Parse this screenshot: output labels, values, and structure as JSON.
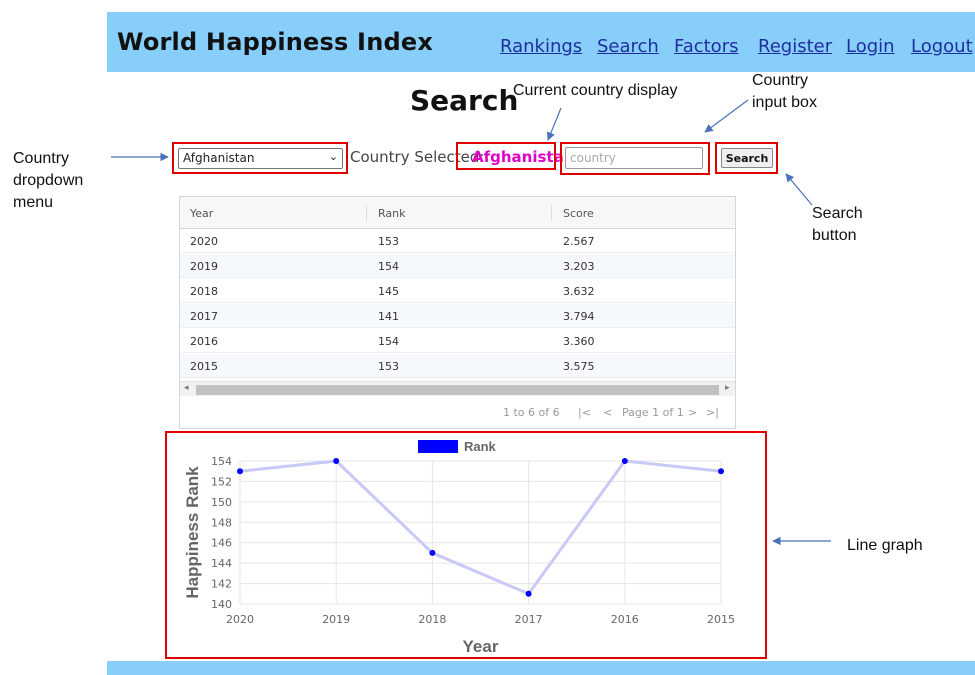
{
  "header": {
    "brand": "World Happiness Index",
    "nav": [
      "Rankings",
      "Search",
      "Factors",
      "Register",
      "Login",
      "Logout"
    ]
  },
  "page": {
    "title": "Search"
  },
  "search": {
    "dropdown_value": "Afghanistan",
    "selected_label": "Country Selected:",
    "selected_country": "Afghanistan",
    "input_placeholder": "country",
    "button_label": "Search"
  },
  "table": {
    "columns": [
      "Year",
      "Rank",
      "Score"
    ],
    "rows": [
      [
        "2020",
        "153",
        "2.567"
      ],
      [
        "2019",
        "154",
        "3.203"
      ],
      [
        "2018",
        "145",
        "3.632"
      ],
      [
        "2017",
        "141",
        "3.794"
      ],
      [
        "2016",
        "154",
        "3.360"
      ],
      [
        "2015",
        "153",
        "3.575"
      ]
    ],
    "pager_summary": "1 to 6 of 6",
    "pager_page": "Page 1 of 1",
    "icons": {
      "first": "first-page-icon",
      "prev": "previous-page-icon",
      "next": "next-page-icon",
      "last": "last-page-icon",
      "scroll_left": "scroll-left-icon",
      "scroll_right": "scroll-right-icon"
    }
  },
  "chart_data": {
    "type": "line",
    "categories": [
      "2020",
      "2019",
      "2018",
      "2017",
      "2016",
      "2015"
    ],
    "series": [
      {
        "name": "Rank",
        "values": [
          153,
          154,
          145,
          141,
          154,
          153
        ],
        "color": "#0000ff",
        "line_color": "#c9c9f7"
      }
    ],
    "xlabel": "Year",
    "ylabel": "Happiness Rank",
    "ylim": [
      140,
      154
    ],
    "yticks": [
      "140",
      "142",
      "144",
      "146",
      "148",
      "150",
      "152",
      "154"
    ],
    "legend": "top-center",
    "grid": true
  },
  "annotations": {
    "dropdown": [
      "Country",
      "dropdown",
      "menu"
    ],
    "current": "Current country display",
    "input": [
      "Country",
      "input box"
    ],
    "button": [
      "Search",
      "button"
    ],
    "chart": "Line graph",
    "highlight_color": "#e00000"
  },
  "colors": {
    "navbar": "#87cefa",
    "link": "#1f2f9f",
    "selected_country": "#e000c8"
  }
}
